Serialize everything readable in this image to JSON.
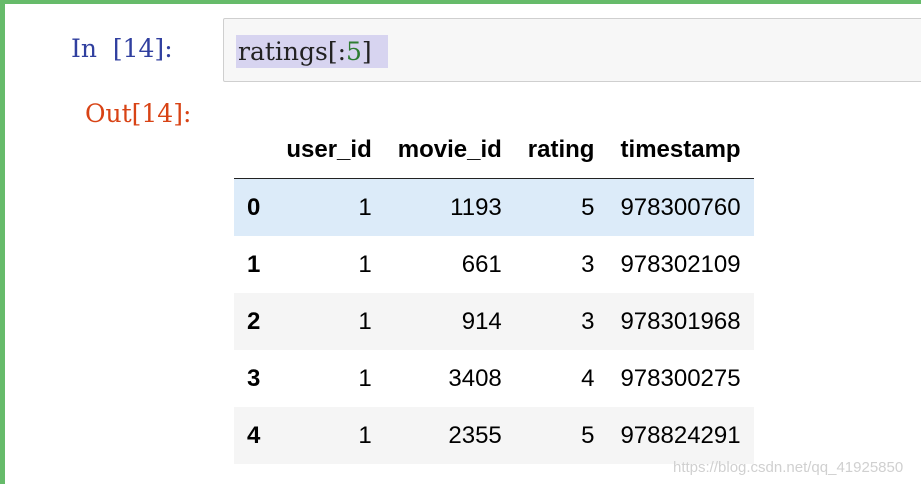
{
  "cell": {
    "in_prompt": "In  [14]:",
    "code_text": "ratings[:",
    "code_num": "5",
    "code_close": "]",
    "out_prompt": "Out[14]:"
  },
  "dataframe": {
    "columns": [
      "",
      "user_id",
      "movie_id",
      "rating",
      "timestamp"
    ],
    "rows": [
      {
        "index": "0",
        "user_id": "1",
        "movie_id": "1193",
        "rating": "5",
        "timestamp": "978300760"
      },
      {
        "index": "1",
        "user_id": "1",
        "movie_id": "661",
        "rating": "3",
        "timestamp": "978302109"
      },
      {
        "index": "2",
        "user_id": "1",
        "movie_id": "914",
        "rating": "3",
        "timestamp": "978301968"
      },
      {
        "index": "3",
        "user_id": "1",
        "movie_id": "3408",
        "rating": "4",
        "timestamp": "978300275"
      },
      {
        "index": "4",
        "user_id": "1",
        "movie_id": "2355",
        "rating": "5",
        "timestamp": "978824291"
      }
    ],
    "hover_row": 0
  },
  "watermark": "https://blog.csdn.net/qq_41925850",
  "colors": {
    "cell_border": "#66bb6a",
    "in_prompt": "#303f9f",
    "out_prompt": "#d84315",
    "selection": "#d7d4f0",
    "hover_row": "#dcebf9"
  }
}
